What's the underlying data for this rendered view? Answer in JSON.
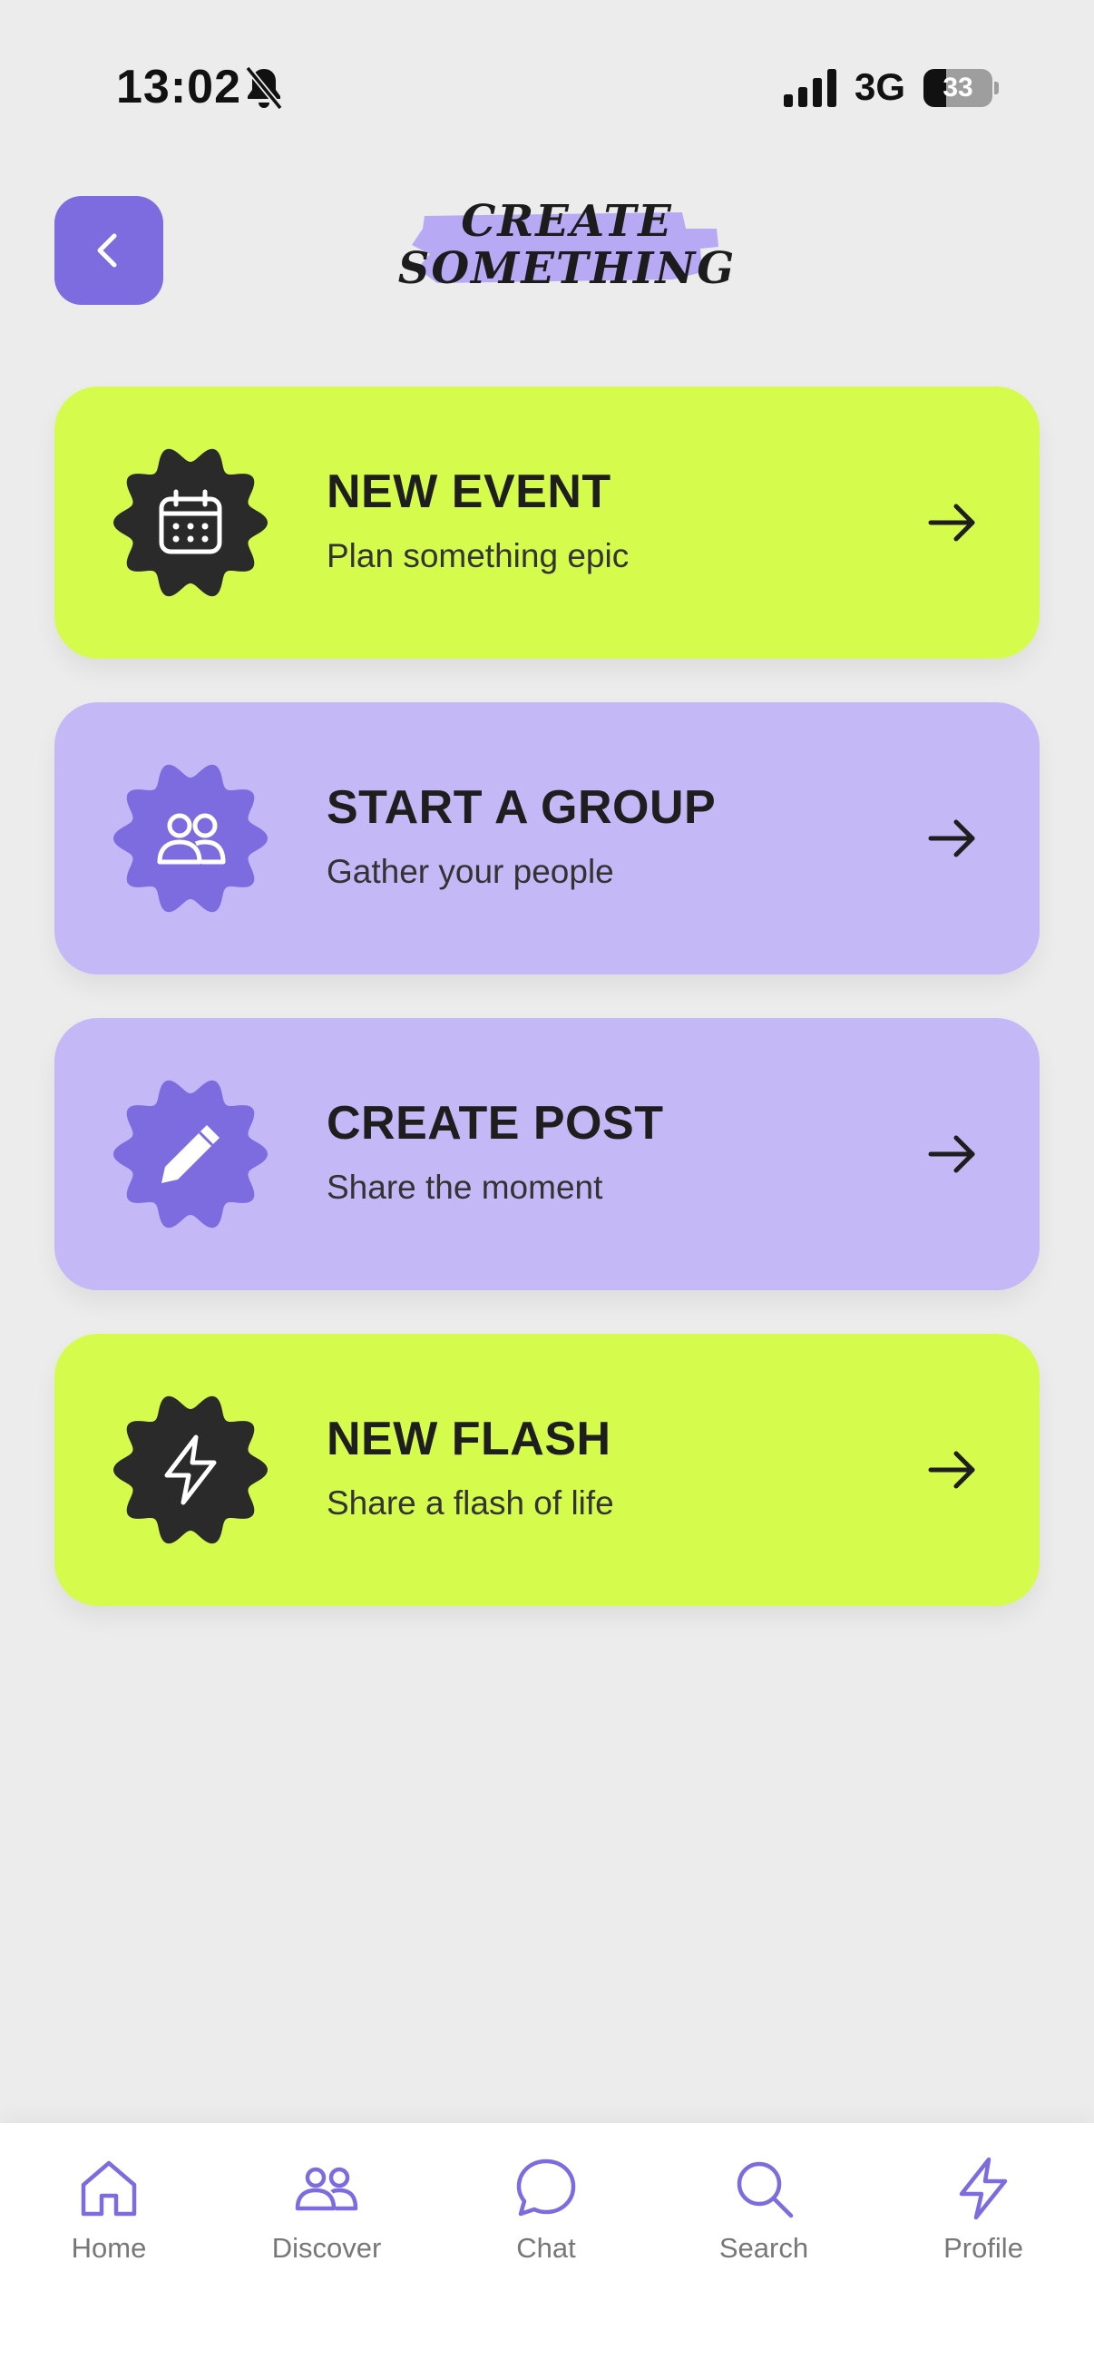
{
  "status_bar": {
    "time": "13:02",
    "network": "3G",
    "battery_level": "33",
    "battery_fraction": 0.33,
    "icons": [
      "bell-slash-icon",
      "signal-bars-icon",
      "battery-icon"
    ]
  },
  "header": {
    "back_icon": "chevron-left-icon",
    "logo_line1": "CREATE",
    "logo_line2": "SOMETHING"
  },
  "cards": [
    {
      "title": "NEW EVENT",
      "subtitle": "Plan something epic",
      "icon": "calendar-icon",
      "theme": "lime"
    },
    {
      "title": "START A GROUP",
      "subtitle": "Gather your people",
      "icon": "people-icon",
      "theme": "lavender"
    },
    {
      "title": "CREATE POST",
      "subtitle": "Share the moment",
      "icon": "pencil-icon",
      "theme": "lavender"
    },
    {
      "title": "NEW FLASH",
      "subtitle": "Share a flash of life",
      "icon": "lightning-icon",
      "theme": "lime"
    }
  ],
  "nav": [
    {
      "label": "Home",
      "icon": "home-icon"
    },
    {
      "label": "Discover",
      "icon": "people-icon"
    },
    {
      "label": "Chat",
      "icon": "chat-bubble-icon"
    },
    {
      "label": "Search",
      "icon": "search-icon"
    },
    {
      "label": "Profile",
      "icon": "lightning-icon"
    }
  ],
  "colors": {
    "background": "#ececec",
    "accent_purple": "#7d6be0",
    "lime": "#d5fc4d",
    "lavender": "#c4b8f7",
    "dark": "#2a2a2a",
    "nav_label": "#777777"
  }
}
